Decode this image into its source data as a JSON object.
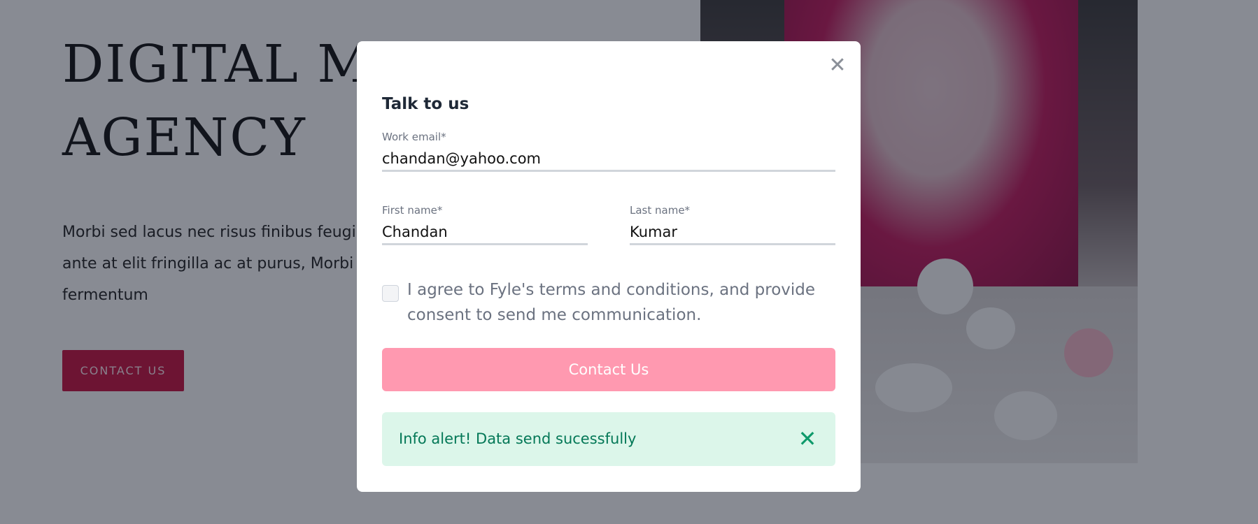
{
  "hero": {
    "title_line1": "DIGITAL MA",
    "title_line2": "AGENCY",
    "text_line1": "Morbi sed lacus nec risus finibus feugia",
    "text_line2": "ante at elit fringilla ac at purus, Morbi se",
    "text_line3": "fermentum",
    "button_label": "CONTACT US"
  },
  "modal": {
    "title": "Talk to us",
    "close_icon": "close-icon",
    "fields": {
      "email": {
        "label": "Work email*",
        "value": "chandan@yahoo.com"
      },
      "first_name": {
        "label": "First name*",
        "value": "Chandan"
      },
      "last_name": {
        "label": "Last name*",
        "value": "Kumar"
      }
    },
    "consent": {
      "line1": "I agree to Fyle's terms and conditions, and provide",
      "line2": "consent to send me communication.",
      "checked": false
    },
    "submit_label": "Contact Us",
    "alert": {
      "strong": "Info alert!",
      "message": " Data send sucessfully",
      "close_icon": "close-icon"
    }
  },
  "colors": {
    "brand": "#c8103e",
    "submit": "#ff99b0",
    "alert_bg": "#dcf6ea",
    "alert_text": "#047857"
  }
}
